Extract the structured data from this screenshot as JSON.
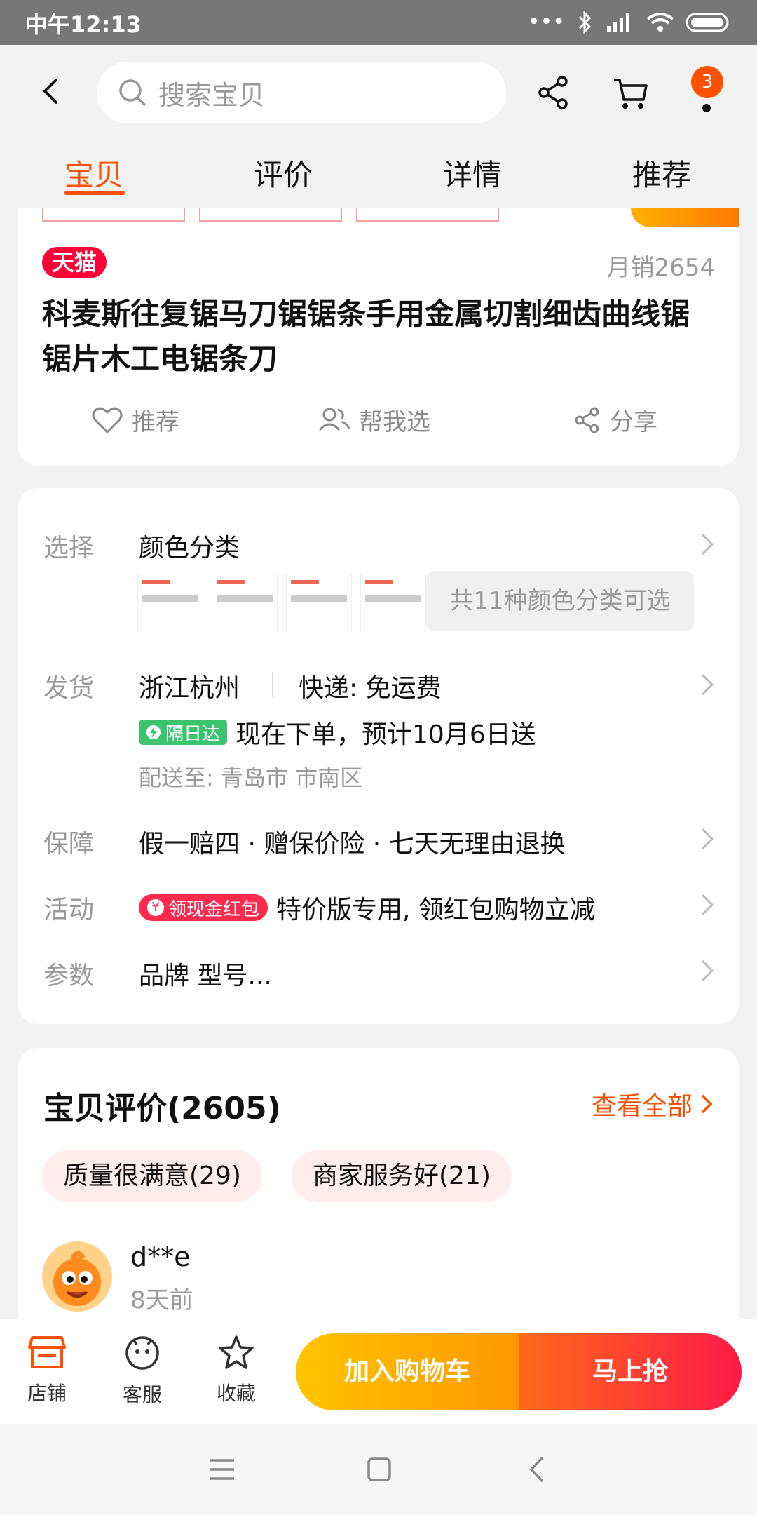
{
  "status_bar": {
    "time": "中午12:13"
  },
  "header": {
    "search_placeholder": "搜索宝贝",
    "cart_badge": "3"
  },
  "tabs": [
    {
      "label": "宝贝",
      "active": true
    },
    {
      "label": "评价",
      "active": false
    },
    {
      "label": "详情",
      "active": false
    },
    {
      "label": "推荐",
      "active": false
    }
  ],
  "product": {
    "store_badge": "天猫",
    "monthly_sales": "月销2654",
    "title": "科麦斯往复锯马刀锯锯条手用金属切割细齿曲线锯锯片木工电锯条刀",
    "actions": [
      {
        "label": "推荐",
        "icon": "heart-icon"
      },
      {
        "label": "帮我选",
        "icon": "people-icon"
      },
      {
        "label": "分享",
        "icon": "share-icon"
      }
    ]
  },
  "options": {
    "select": {
      "label": "选择",
      "value": "颜色分类",
      "more": "共11种颜色分类可选"
    },
    "shipping": {
      "label": "发货",
      "origin": "浙江杭州",
      "express": "快递: 免运费",
      "badge": "隔日达",
      "eta": "现在下单，预计10月6日送",
      "deliver_to": "配送至: 青岛市 市南区"
    },
    "guarantee": {
      "label": "保障",
      "value": "假一赔四 · 赠保价险 · 七天无理由退换"
    },
    "promo": {
      "label": "活动",
      "badge": "领现金红包",
      "value": "特价版专用, 领红包购物立减"
    },
    "params": {
      "label": "参数",
      "value": "品牌 型号..."
    }
  },
  "reviews": {
    "title": "宝贝评价(2605)",
    "view_all": "查看全部",
    "tags": [
      "质量很满意(29)",
      "商家服务好(21)"
    ],
    "first": {
      "user": "d**e",
      "time": "8天前"
    }
  },
  "bottom_bar": {
    "store": "店铺",
    "service": "客服",
    "favorite": "收藏",
    "add_cart": "加入购物车",
    "buy_now": "马上抢"
  },
  "colors": {
    "accent": "#ff5000",
    "tmall": "#ff0036"
  }
}
